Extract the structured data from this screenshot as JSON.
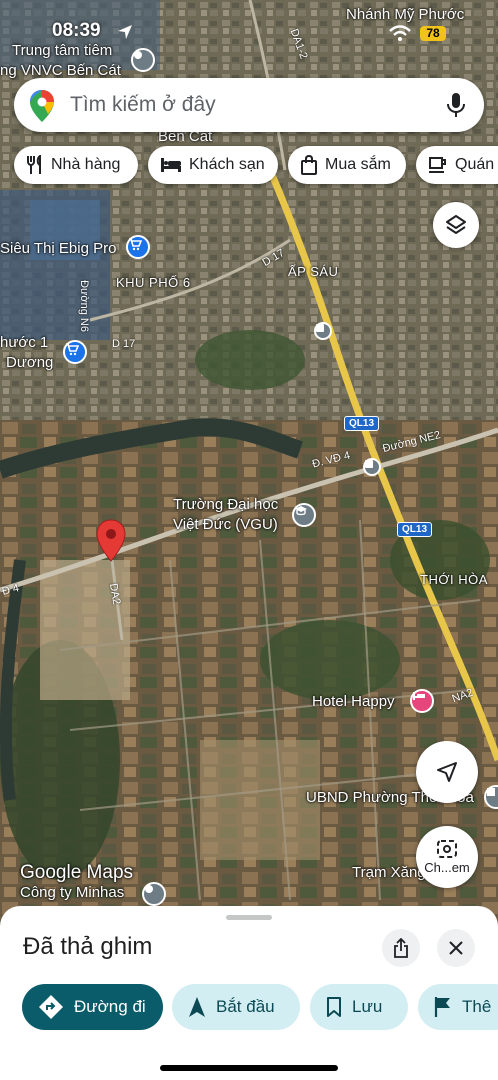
{
  "status_bar": {
    "time": "08:39",
    "battery": "78"
  },
  "search": {
    "placeholder": "Tìm kiếm ở đây"
  },
  "chips": [
    {
      "label": "Nhà hàng",
      "icon": "restaurant-icon"
    },
    {
      "label": "Khách sạn",
      "icon": "hotel-icon"
    },
    {
      "label": "Mua sắm",
      "icon": "shopping-icon"
    },
    {
      "label": "Quán",
      "icon": "cafe-icon"
    }
  ],
  "map": {
    "labels": {
      "nhanh_my_phuoc": "Nhánh Mỹ Phước",
      "trung_tam_tiem_1": "Trung tâm tiêm",
      "trung_tam_tiem_2": "ng VNVC Bến Cát",
      "ben_cat": "Bến Cát",
      "sieu_thi": "Siêu Thị Ebig Pro",
      "khu_pho_6": "KHU PHỐ 6",
      "ap_sau": "ẤP SÁU",
      "phuoc_1": "hước 1",
      "duong_2": "Dương",
      "truong_1": "Trường Đại học",
      "truong_2": "Việt Đức (VGU)",
      "thoi_hoa": "THỚI HÒA",
      "hotel_happy": "Hotel Happy",
      "ubnd": "UBND Phường Thới Hòa",
      "tram_xang": "Trạm Xăng ... SD",
      "cong_ty": "Công ty Minhas",
      "google_maps": "Google Maps"
    },
    "roads": {
      "da1_2": "DA1-2",
      "d17_a": "D 17",
      "d17_b": "D 17",
      "duong_n6": "Đường N6",
      "vd4": "Đ. VĐ 4",
      "ne2": "Đường NE2",
      "d4": "Đ 4",
      "da2": "DA2",
      "na2": "NA2",
      "ql13_a": "QL13",
      "ql13_b": "QL13"
    },
    "street_view_label": "Ch...em"
  },
  "sheet": {
    "title": "Đã thả ghim",
    "actions": [
      {
        "label": "Đường đi",
        "icon": "directions-icon"
      },
      {
        "label": "Bắt đầu",
        "icon": "navigation-arrow-icon"
      },
      {
        "label": "Lưu",
        "icon": "bookmark-icon"
      },
      {
        "label": "Thê",
        "icon": "flag-icon"
      }
    ]
  },
  "colors": {
    "primary_action": "#0b5c6a",
    "secondary_action": "#d3eef2",
    "pin": "#e53935",
    "poi_blue": "#1a73e8",
    "poi_pink": "#e6467b"
  }
}
